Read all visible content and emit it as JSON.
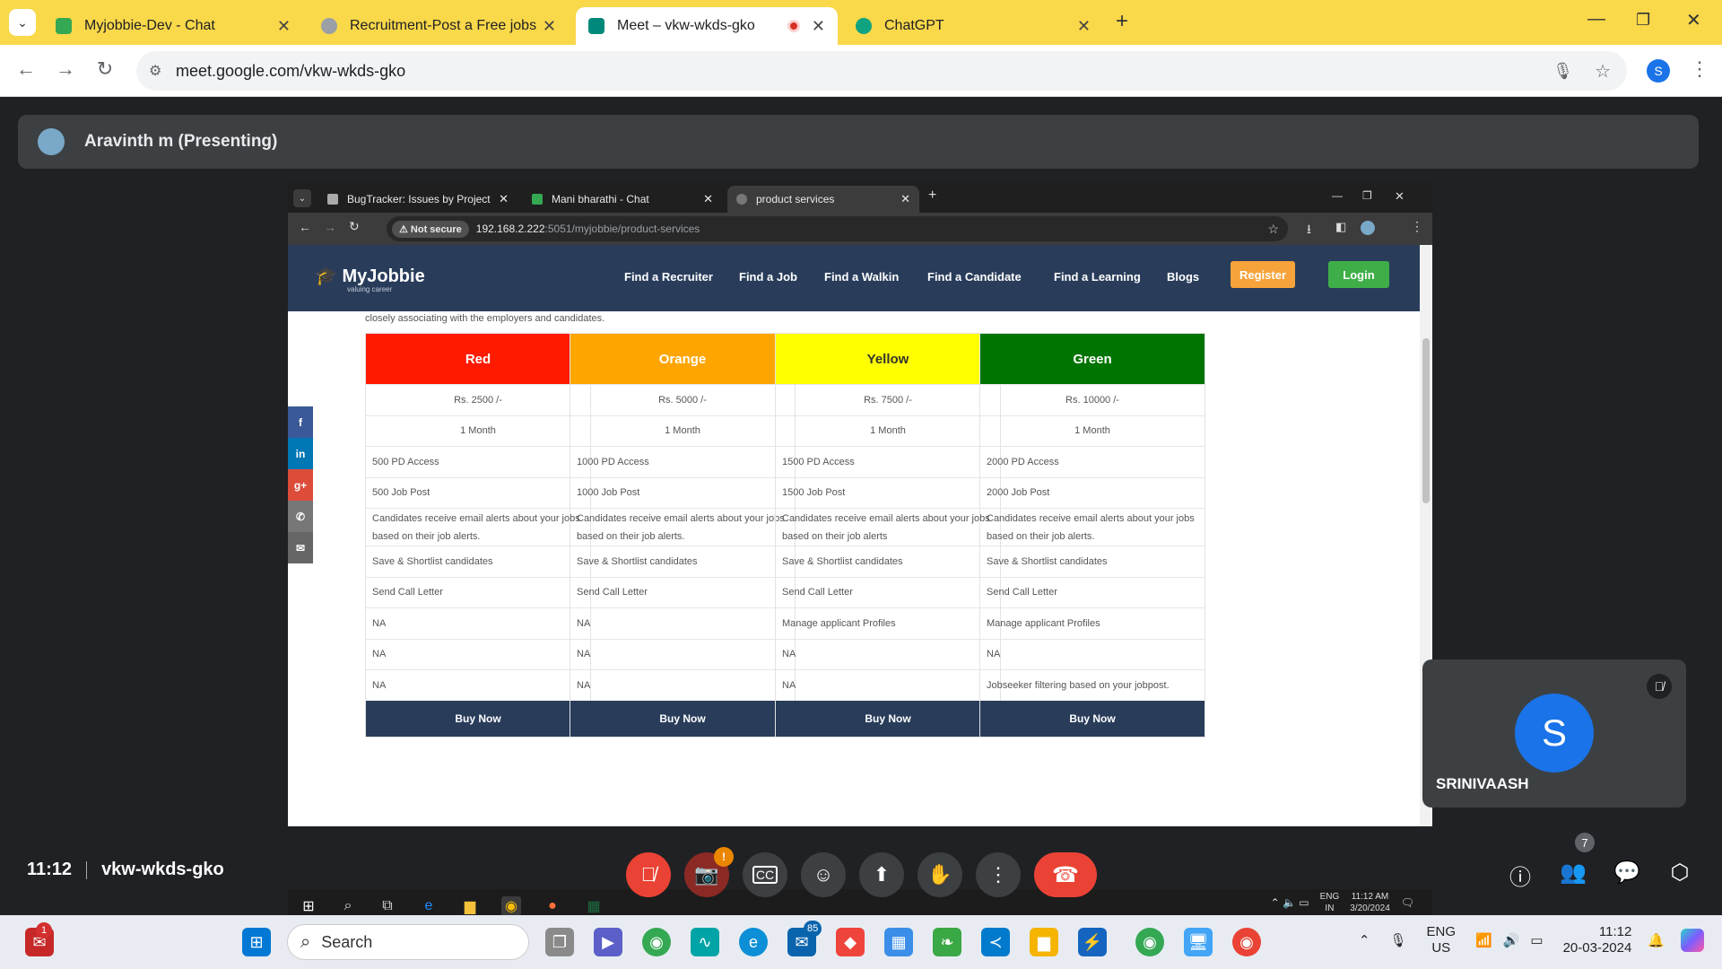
{
  "browser": {
    "tabs": [
      {
        "label": "Myjobbie-Dev - Chat",
        "color": "#34a853"
      },
      {
        "label": "Recruitment-Post a Free jobs in",
        "color": "#9aa0a6"
      },
      {
        "label": "Meet – vkw-wkds-gko",
        "color": "#00897b"
      },
      {
        "label": "ChatGPT",
        "color": "#10a37f"
      }
    ],
    "url": "meet.google.com/vkw-wkds-gko",
    "profile_initial": "S"
  },
  "meet": {
    "presenter": "Aravinth m (Presenting)",
    "time": "11:12",
    "meeting_code": "vkw-wkds-gko",
    "self_name": "SRINIVAASH",
    "self_initial": "S",
    "participants_count": "7",
    "camera_badge": "!"
  },
  "shared": {
    "tabs": [
      "BugTracker: Issues by Project",
      "Mani bharathi - Chat",
      "product services"
    ],
    "not_secure": "Not secure",
    "url_host": "192.168.2.222",
    "url_path": ":5051/myjobbie/product-services",
    "site": {
      "logo": "MyJobbie",
      "logo_tag": "valuing career",
      "nav": [
        "Find a Recruiter",
        "Find a Job",
        "Find a Walkin",
        "Find a Candidate",
        "Find a Learning",
        "Blogs"
      ],
      "register": "Register",
      "login": "Login",
      "intro": "closely associating with the employers and candidates.",
      "plans": [
        {
          "name": "Red",
          "color": "#ff1a00",
          "text_color": "#ffffff",
          "price": "Rs. 2500 /-",
          "duration": "1 Month",
          "pd": "500 PD Access",
          "jobs": "500 Job Post",
          "alerts": "Candidates receive email alerts about your jobs based on their job alerts.",
          "shortlist": "Save & Shortlist candidates",
          "call": "Send Call Letter",
          "f1": "NA",
          "f2": "NA",
          "f3": "NA",
          "buy": "Buy Now"
        },
        {
          "name": "Orange",
          "color": "#ffa500",
          "text_color": "#ffffff",
          "price": "Rs. 5000 /-",
          "duration": "1 Month",
          "pd": "1000 PD Access",
          "jobs": "1000 Job Post",
          "alerts": "Candidates receive email alerts about your jobs based on their job alerts.",
          "shortlist": "Save & Shortlist candidates",
          "call": "Send Call Letter",
          "f1": "NA",
          "f2": "NA",
          "f3": "NA",
          "buy": "Buy Now"
        },
        {
          "name": "Yellow",
          "color": "#ffff00",
          "text_color": "#333333",
          "price": "Rs. 7500 /-",
          "duration": "1 Month",
          "pd": "1500 PD Access",
          "jobs": "1500 Job Post",
          "alerts": "Candidates receive email alerts about your jobs based on their job alerts",
          "shortlist": "Save & Shortlist candidates",
          "call": "Send Call Letter",
          "f1": "Manage applicant Profiles",
          "f2": "NA",
          "f3": "NA",
          "buy": "Buy Now"
        },
        {
          "name": "Green",
          "color": "#007400",
          "text_color": "#ffffff",
          "price": "Rs. 10000 /-",
          "duration": "1 Month",
          "pd": "2000 PD Access",
          "jobs": "2000 Job Post",
          "alerts": "Candidates receive email alerts about your jobs based on their job alerts.",
          "shortlist": "Save & Shortlist candidates",
          "call": "Send Call Letter",
          "f1": "Manage applicant Profiles",
          "f2": "NA",
          "f3": "Jobseeker filtering based on your jobpost.",
          "buy": "Buy Now"
        }
      ]
    },
    "taskbar": {
      "lang1": "ENG",
      "lang2": "IN",
      "time": "11:12 AM",
      "date": "3/20/2024"
    }
  },
  "windows": {
    "search": "Search",
    "lang1": "ENG",
    "lang2": "US",
    "time": "11:12",
    "date": "20-03-2024",
    "notif_badge": "1",
    "mail_badge": "85"
  }
}
